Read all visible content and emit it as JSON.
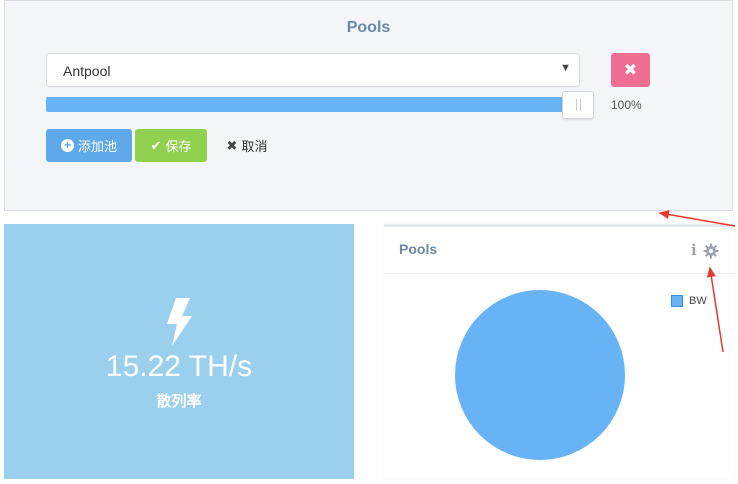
{
  "pools_panel": {
    "title": "Pools",
    "select_value": "Antpool",
    "slider_percent_label": "100%",
    "slider_level": 1.0,
    "add_label": "添加池",
    "save_label": "保存",
    "cancel_label": "取消"
  },
  "hashrate": {
    "value": "15.22 TH/s",
    "label": "散列率"
  },
  "pool_chart": {
    "title": "Pools",
    "info_icon": "i",
    "chart_data": {
      "type": "pie",
      "series": [
        {
          "name": "BW",
          "value": 100,
          "color": "#68b3f5"
        }
      ],
      "legend_position": "top-right"
    }
  },
  "colors": {
    "accent_blue": "#5fa8ea",
    "save_green": "#8fd14f",
    "remove_pink": "#f06d93",
    "tile_blue": "#9ad0ee",
    "pie_blue": "#68b3f5",
    "annotation_red": "#e8392f"
  },
  "icons": [
    "remove-icon",
    "plus-circle-icon",
    "check-icon",
    "close-icon",
    "bolt-icon",
    "info-icon",
    "gear-icon"
  ]
}
